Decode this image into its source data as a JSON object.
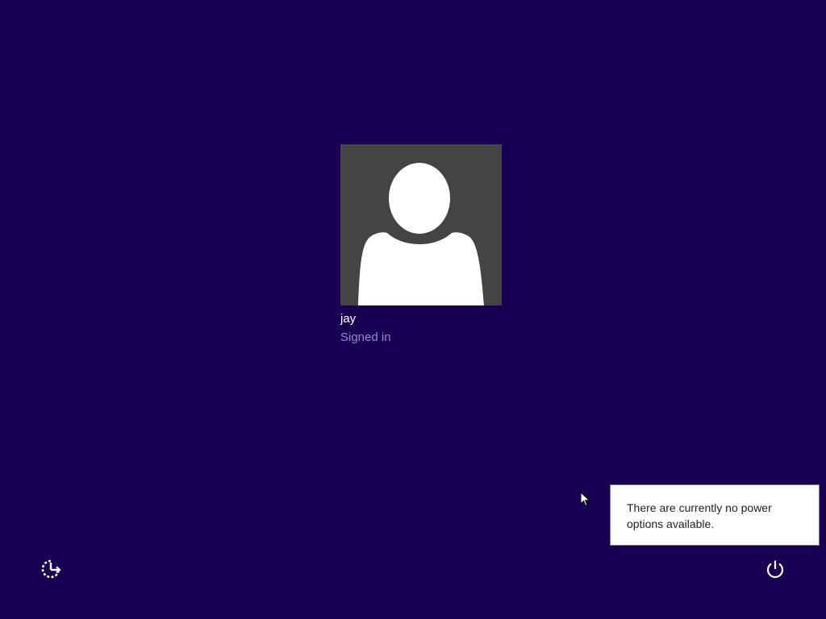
{
  "lock_screen": {
    "background_color": "#180052",
    "user": {
      "name": "jay",
      "status": "Signed in",
      "avatar_icon": "default-user-silhouette-icon",
      "avatar_bg_color": "#444444"
    },
    "ease_of_access": {
      "icon": "ease-of-access-icon"
    },
    "power": {
      "icon": "power-icon"
    },
    "power_tooltip": {
      "text": "There are currently no power options available."
    }
  }
}
